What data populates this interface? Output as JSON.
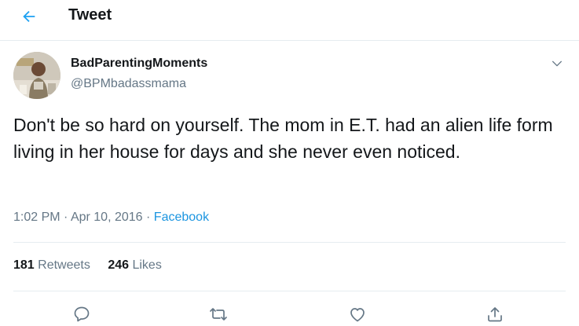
{
  "header": {
    "title": "Tweet",
    "back_icon": "arrow-left-icon"
  },
  "author": {
    "name": "BadParentingMoments",
    "handle": "@BPMbadassmama"
  },
  "tweet": {
    "text": "Don't be so hard on yourself.  The mom in E.T. had an alien life form living in her house for days and she never even noticed.",
    "time": "1:02 PM",
    "date": "Apr 10, 2016",
    "separator": "·",
    "source": "Facebook"
  },
  "stats": {
    "retweets_count": "181",
    "retweets_label": "Retweets",
    "likes_count": "246",
    "likes_label": "Likes"
  },
  "actions": [
    "reply-icon",
    "retweet-icon",
    "like-icon",
    "share-icon"
  ],
  "colors": {
    "accent": "#1da1f2",
    "link": "#1b95e0",
    "secondary_text": "#657786",
    "divider": "#e6ecf0"
  }
}
